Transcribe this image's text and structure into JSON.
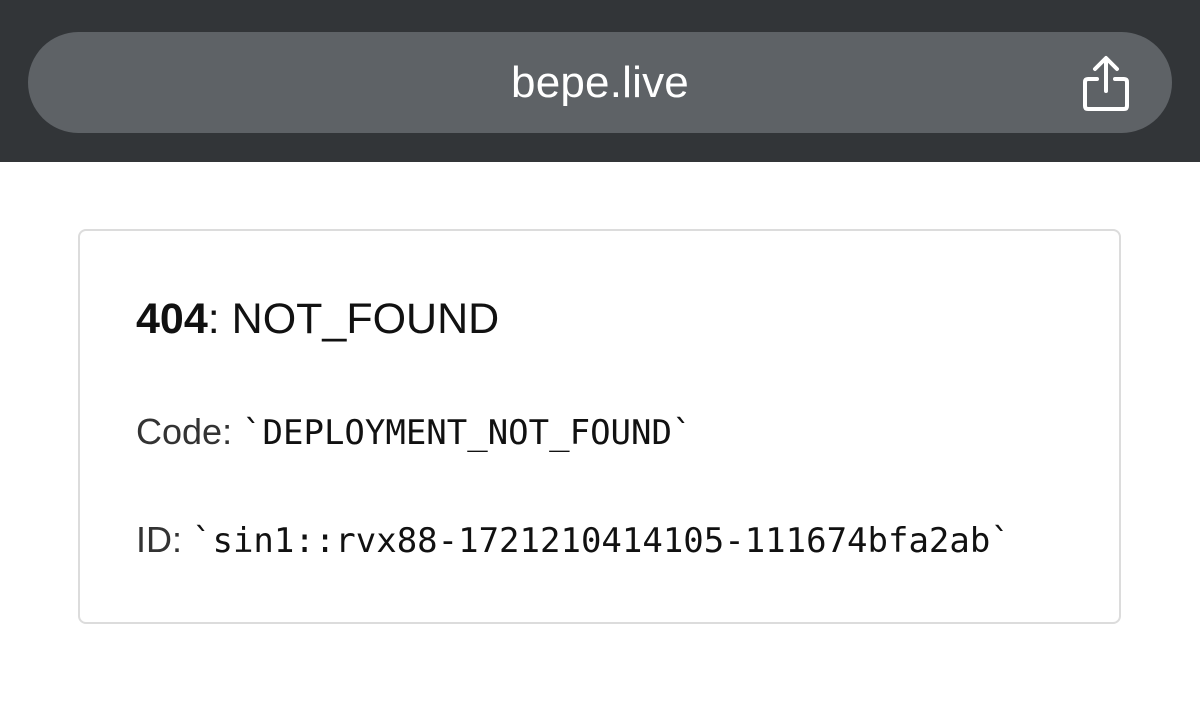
{
  "browser": {
    "url": "bepe.live",
    "share_icon": "share-icon"
  },
  "error": {
    "status_code": "404",
    "separator": ": ",
    "status_text": "NOT_FOUND",
    "code_label": "Code: ",
    "code_value": "`DEPLOYMENT_NOT_FOUND`",
    "id_label": "ID: ",
    "id_value": "`sin1::rvx88-1721210414105-111674bfa2ab`"
  },
  "colors": {
    "topbar": "#323538",
    "urlbar": "#5e6266",
    "card_border": "#dcdcdc"
  }
}
